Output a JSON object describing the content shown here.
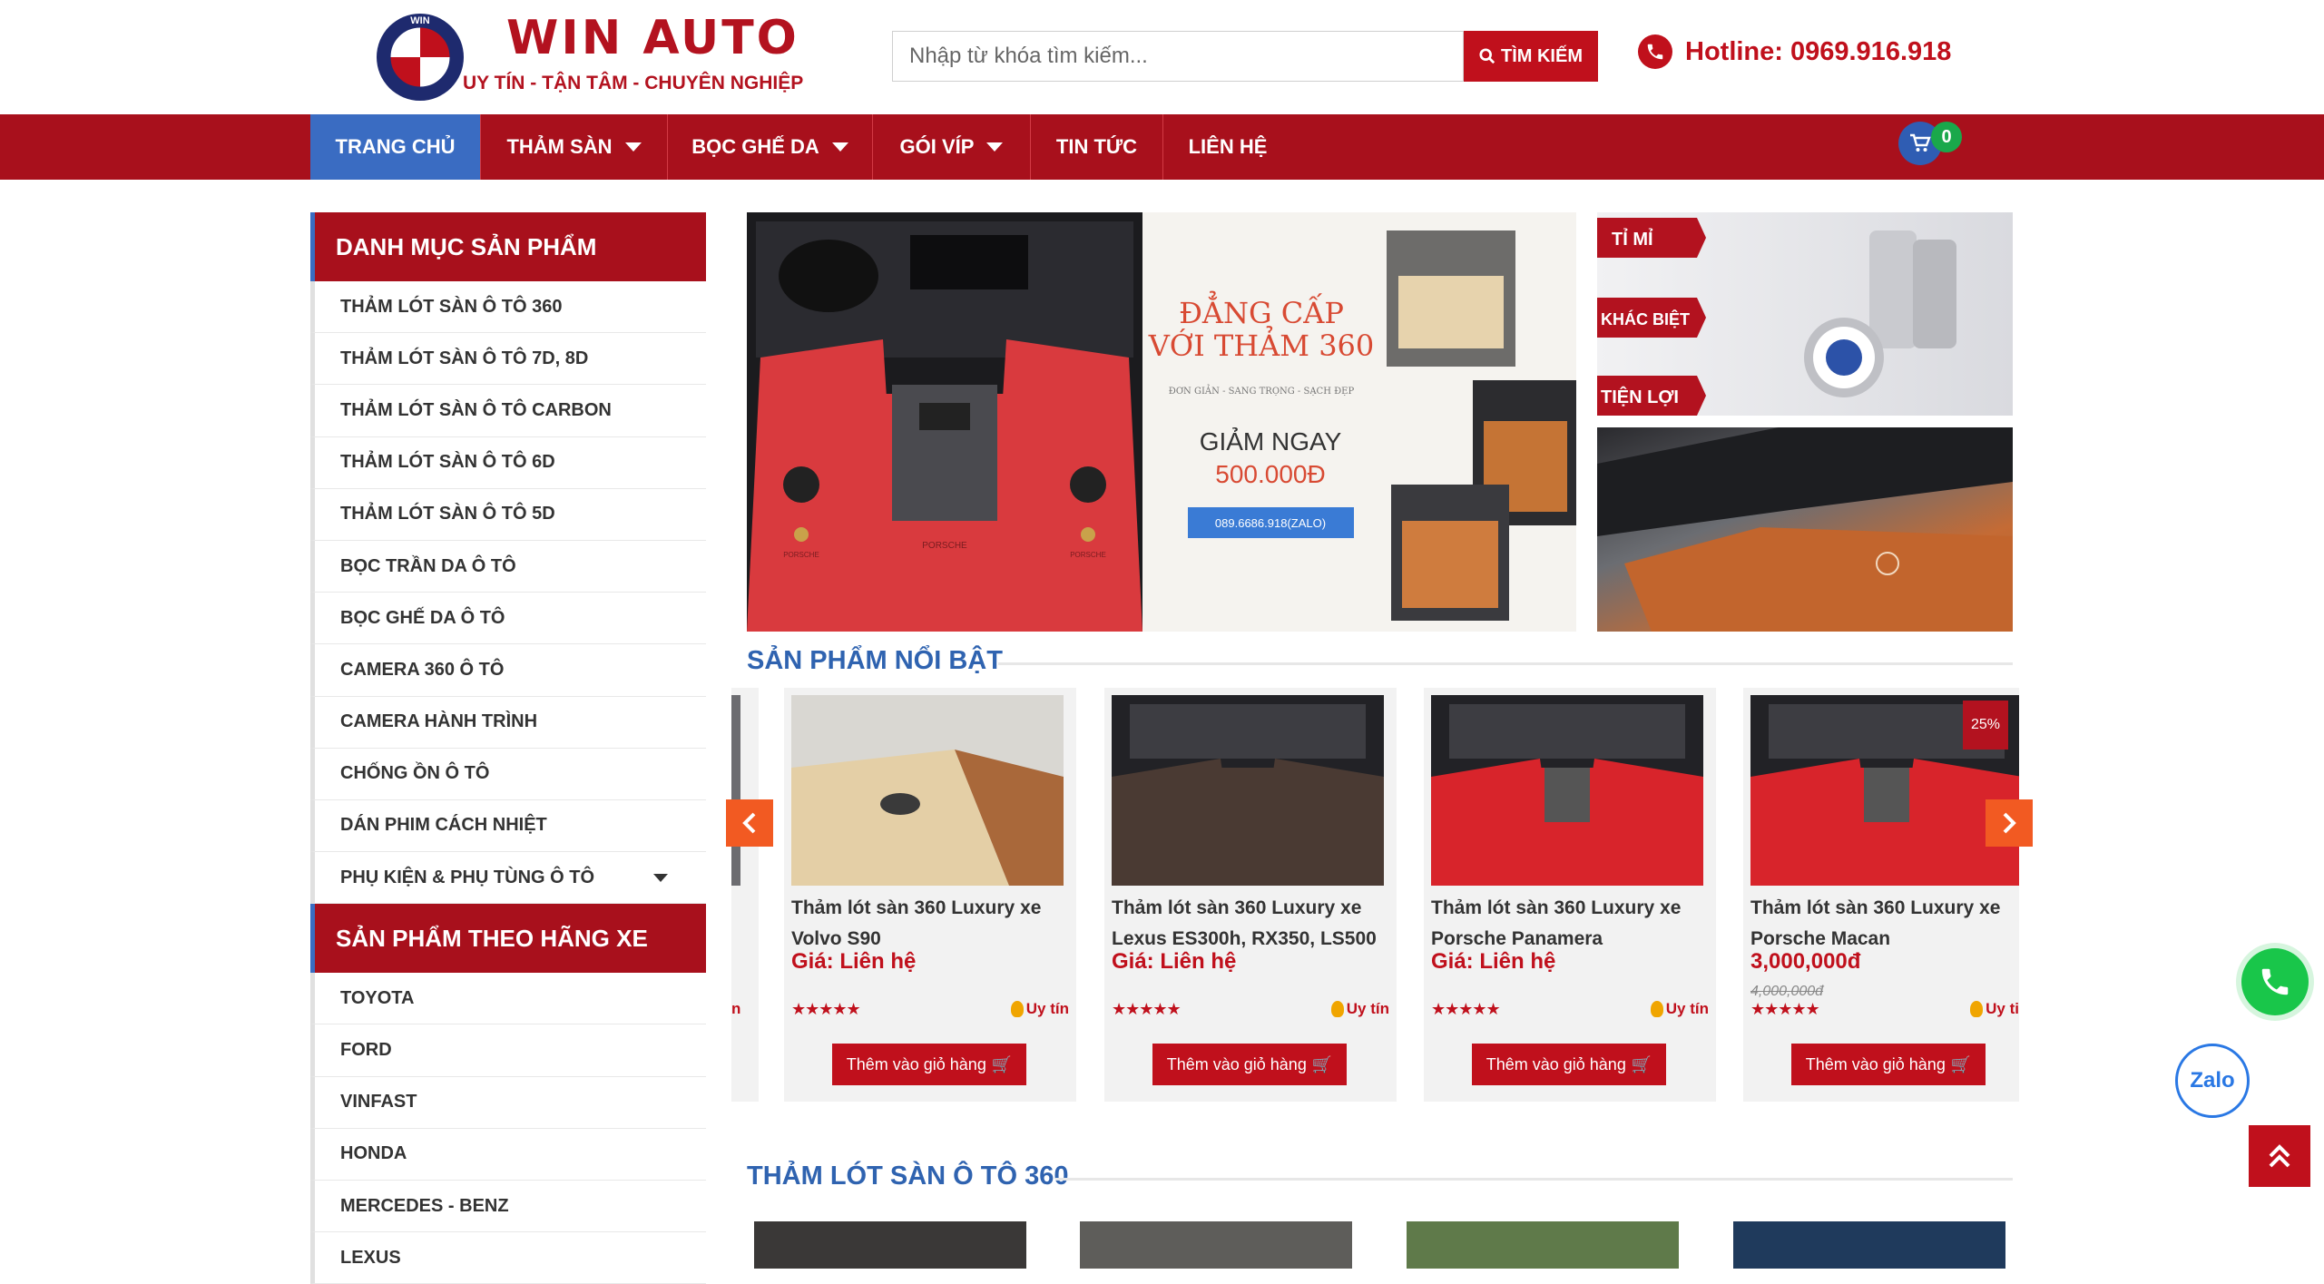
{
  "header": {
    "brand_name": "WIN AUTO",
    "brand_slogan": "UY TÍN - TẬN TÂM - CHUYÊN NGHIỆP",
    "logo_letters": "WIN",
    "search": {
      "placeholder": "Nhập từ khóa tìm kiếm...",
      "value": "",
      "button_label": "TÌM KIẾM"
    },
    "hotline": "Hotline: 0969.916.918"
  },
  "nav": {
    "items": [
      {
        "label": "TRANG CHỦ",
        "active": true,
        "has_dropdown": false
      },
      {
        "label": "THẢM SÀN",
        "active": false,
        "has_dropdown": true
      },
      {
        "label": "BỌC GHẾ DA",
        "active": false,
        "has_dropdown": true
      },
      {
        "label": "GÓI VÍP",
        "active": false,
        "has_dropdown": true
      },
      {
        "label": "TIN TỨC",
        "active": false,
        "has_dropdown": false
      },
      {
        "label": "LIÊN HỆ",
        "active": false,
        "has_dropdown": false
      }
    ],
    "cart_count": "0"
  },
  "sidebar": {
    "categories_title": "DANH MỤC SẢN PHẨM",
    "categories": [
      "THẢM LÓT SÀN Ô TÔ 360",
      "THẢM LÓT SÀN Ô TÔ 7D, 8D",
      "THẢM LÓT SÀN Ô TÔ CARBON",
      "THẢM LÓT SÀN Ô TÔ 6D",
      "THẢM LÓT SÀN Ô TÔ 5D",
      "BỌC TRẦN DA Ô TÔ",
      "BỌC GHẾ DA Ô TÔ",
      "CAMERA 360 Ô TÔ",
      "CAMERA HÀNH TRÌNH",
      "CHỐNG ỒN Ô TÔ",
      "DÁN PHIM CÁCH NHIỆT",
      "PHỤ KIỆN & PHỤ TÙNG Ô TÔ"
    ],
    "brands_title": "SẢN PHẨM THEO HÃNG XE",
    "brands": [
      "TOYOTA",
      "FORD",
      "VINFAST",
      "HONDA",
      "MERCEDES - BENZ",
      "LEXUS"
    ]
  },
  "banner": {
    "headline_1": "ĐẲNG CẤP",
    "headline_2": "VỚI THẢM 360",
    "tagline": "ĐƠN GIẢN - SANG TRỌNG - SẠCH ĐẸP",
    "offer_1": "GIẢM NGAY",
    "offer_2": "500.000Đ",
    "contact": "089.6686.918(ZALO)",
    "mat_brand": "PORSCHE",
    "side_labels": [
      "TỈ MỈ",
      "KHÁC BIỆT",
      "TIỆN LỢI"
    ]
  },
  "featured": {
    "title": "SẢN PHẨM NỔI BẬT",
    "partial_letter": "n",
    "products": [
      {
        "name": "Thảm lót sàn 360 Luxury xe Volvo S90",
        "price": "Giá: Liên hệ",
        "old_price": "",
        "discount": "",
        "stars": "★★★★★",
        "badge": "Uy tín",
        "button": "Thêm vào giỏ hàng",
        "mat_color": "#e4cfa6"
      },
      {
        "name": "Thảm lót sàn 360 Luxury xe Lexus ES300h, RX350, LS500",
        "price": "Giá: Liên hệ",
        "old_price": "",
        "discount": "",
        "stars": "★★★★★",
        "badge": "Uy tín",
        "button": "Thêm vào giỏ hàng",
        "mat_color": "#4a3a33"
      },
      {
        "name": "Thảm lót sàn 360 Luxury xe Porsche Panamera",
        "price": "Giá: Liên hệ",
        "old_price": "",
        "discount": "",
        "stars": "★★★★★",
        "badge": "Uy tín",
        "button": "Thêm vào giỏ hàng",
        "mat_color": "#d8242b"
      },
      {
        "name": "Thảm lót sàn 360 Luxury xe Porsche Macan",
        "price": "3,000,000đ",
        "old_price": "4,000,000đ",
        "discount": "25%",
        "stars": "★★★★★",
        "badge": "Uy ti",
        "button": "Thêm vào giỏ hàng",
        "mat_color": "#d8242b"
      }
    ]
  },
  "section_360": {
    "title": "THẢM LÓT SÀN Ô TÔ 360"
  },
  "floating": {
    "zalo_label": "Zalo"
  },
  "colors": {
    "brand_red": "#a8101c",
    "button_red": "#c0101c",
    "nav_active": "#3a6cc2",
    "section_blue": "#2f63b0",
    "arrow_orange": "#f25a22",
    "phone_green": "#19c64a"
  }
}
